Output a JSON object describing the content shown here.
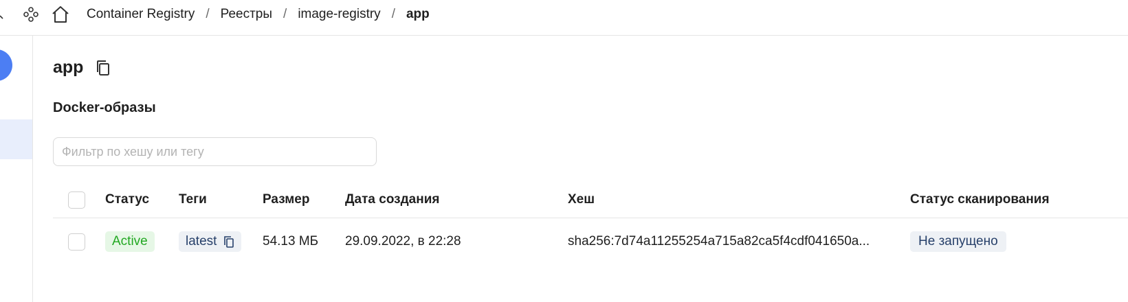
{
  "breadcrumb": {
    "items": [
      {
        "label": "Container Registry"
      },
      {
        "label": "Реестры"
      },
      {
        "label": "image-registry"
      },
      {
        "label": "app"
      }
    ],
    "separator": "/"
  },
  "page": {
    "title": "app",
    "section_title": "Docker-образы"
  },
  "filter": {
    "placeholder": "Фильтр по хешу или тегу",
    "value": ""
  },
  "table": {
    "columns": [
      "Статус",
      "Теги",
      "Размер",
      "Дата создания",
      "Хеш",
      "Статус сканирования"
    ],
    "rows": [
      {
        "status": "Active",
        "tag": "latest",
        "size": "54.13 МБ",
        "created": "29.09.2022, в 22:28",
        "hash": "sha256:7d74a11255254a715a82ca5f4cdf041650a...",
        "scan_status": "Не запущено"
      }
    ]
  },
  "icons": {
    "apps": "apps-icon",
    "home": "home-icon",
    "copy": "copy-icon",
    "chevron": "chevron-icon"
  },
  "colors": {
    "accent": "#4c7ef3",
    "active_status": "#22a822",
    "active_bg": "#e6f7e6",
    "tag_bg": "#eef1f5"
  }
}
